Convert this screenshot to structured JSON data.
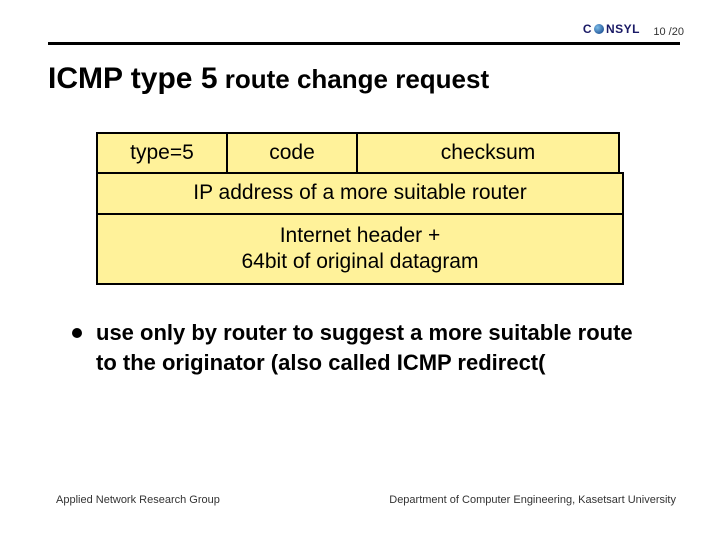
{
  "header": {
    "logo_text_pre": "C",
    "logo_text_post": "NSYL",
    "page_current": "10",
    "page_sep": " /",
    "page_total": "20"
  },
  "title": {
    "main": "ICMP type 5",
    "sub": "  route change request"
  },
  "packet": {
    "row1": {
      "type": "type=5",
      "code": "code",
      "checksum": "checksum"
    },
    "row2": "IP address of a more suitable router",
    "row3": "Internet header +\n64bit of original datagram"
  },
  "bullets": {
    "items": [
      "use only by router to suggest a more suitable route to the originator (also called ICMP redirect("
    ]
  },
  "footer": {
    "left": "Applied Network Research Group",
    "right": "Department of Computer Engineering, Kasetsart University"
  }
}
